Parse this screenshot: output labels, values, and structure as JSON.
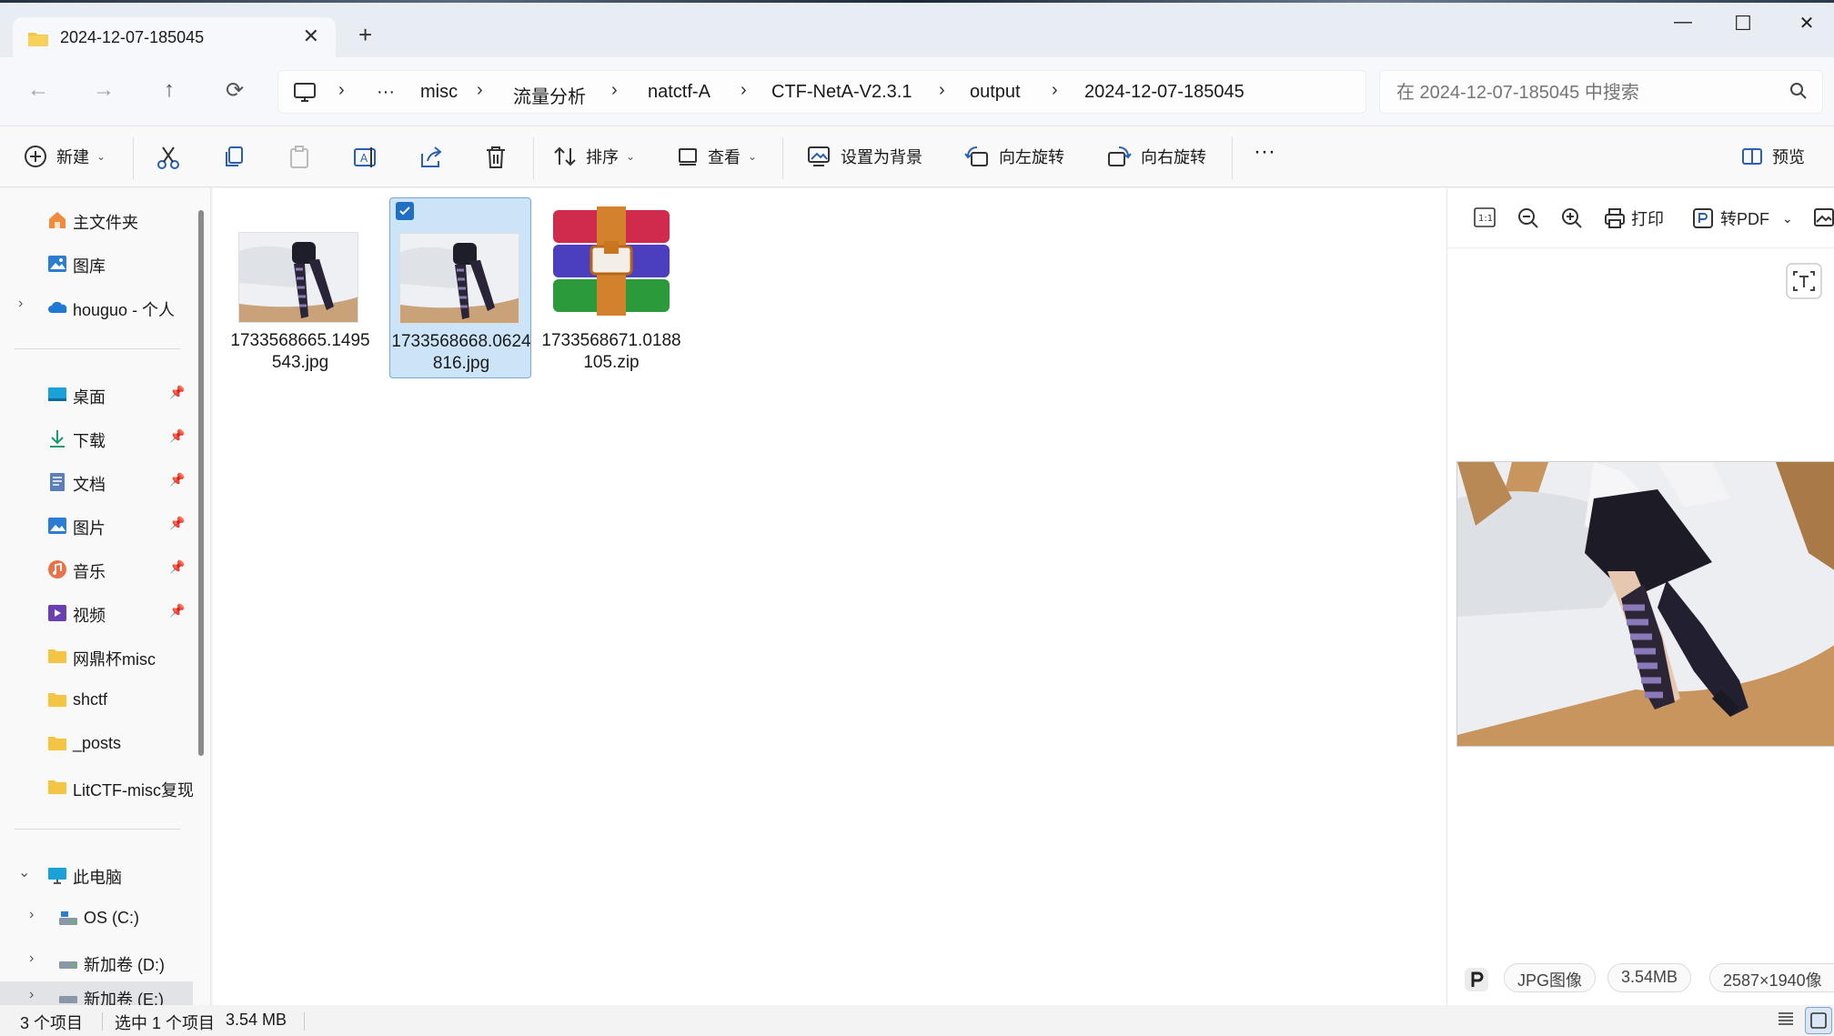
{
  "tab": {
    "title": "2024-12-07-185045",
    "close": "✕",
    "new": "+"
  },
  "window_controls": {
    "minimize": "—",
    "maximize": "☐",
    "close": "✕"
  },
  "nav": {
    "back": "←",
    "forward": "→",
    "up": "↑",
    "refresh": "⟳"
  },
  "breadcrumb": {
    "more": "···",
    "items": [
      "misc",
      "流量分析",
      "natctf-A",
      "CTF-NetA-V2.3.1",
      "output",
      "2024-12-07-185045"
    ],
    "separator": "›"
  },
  "search": {
    "placeholder": "在 2024-12-07-185045 中搜索"
  },
  "toolbar": {
    "new_label": "新建",
    "sort_label": "排序",
    "view_label": "查看",
    "set_bg_label": "设置为背景",
    "rotate_left_label": "向左旋转",
    "rotate_right_label": "向右旋转",
    "more_label": "···",
    "preview_label": "预览"
  },
  "sidebar": {
    "quick": [
      {
        "label": "主文件夹"
      },
      {
        "label": "图库"
      },
      {
        "label": "houguo - 个人"
      }
    ],
    "pinned": [
      {
        "label": "桌面"
      },
      {
        "label": "下载"
      },
      {
        "label": "文档"
      },
      {
        "label": "图片"
      },
      {
        "label": "音乐"
      },
      {
        "label": "视频"
      }
    ],
    "folders": [
      {
        "label": "网鼎杯misc"
      },
      {
        "label": "shctf"
      },
      {
        "label": "_posts"
      },
      {
        "label": "LitCTF-misc复现"
      }
    ],
    "pc": {
      "label": "此电脑"
    },
    "drives": [
      {
        "label": "OS (C:)"
      },
      {
        "label": "新加卷 (D:)"
      },
      {
        "label": "新加卷 (E:)"
      }
    ]
  },
  "files": [
    {
      "name": "1733568665.1495543.jpg",
      "type": "image",
      "selected": false
    },
    {
      "name": "1733568668.0624816.jpg",
      "type": "image",
      "selected": true
    },
    {
      "name": "1733568671.0188105.zip",
      "type": "archive",
      "selected": false
    }
  ],
  "preview": {
    "print_label": "打印",
    "topdf_label": "转PDF",
    "file_type": "JPG图像",
    "file_size": "3.54MB",
    "dimensions": "2587×1940像"
  },
  "status": {
    "item_count": "3 个项目",
    "selection": "选中 1 个项目",
    "selection_size": "3.54 MB"
  },
  "colors": {
    "accent": "#1f6fc5",
    "selection_bg": "#cce4f7",
    "folder": "#f4c542"
  }
}
